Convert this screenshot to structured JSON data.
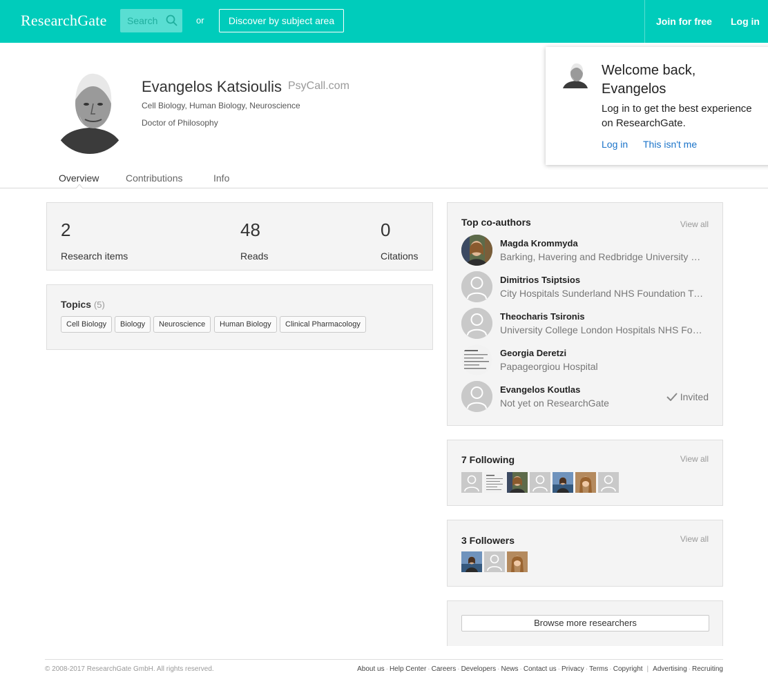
{
  "header": {
    "logo": "ResearchGate",
    "search_placeholder": "Search",
    "or_label": "or",
    "discover_label": "Discover by subject area",
    "join_label": "Join for free",
    "login_label": "Log in",
    "brand_color": "#00ccbb"
  },
  "profile": {
    "name": "Evangelos Katsioulis",
    "website": "PsyCall.com",
    "fields": "Cell Biology, Human Biology, Neuroscience",
    "degree": "Doctor of Philosophy",
    "tabs": [
      "Overview",
      "Contributions",
      "Info"
    ],
    "active_tab": "Overview"
  },
  "popup": {
    "title": "Welcome back, Evangelos",
    "text": "Log in to get the best experience on ResearchGate.",
    "login_link": "Log in",
    "not_me_link": "This isn't me"
  },
  "stats": [
    {
      "value": "2",
      "label": "Research items"
    },
    {
      "value": "48",
      "label": "Reads"
    },
    {
      "value": "0",
      "label": "Citations"
    }
  ],
  "topics": {
    "title": "Topics",
    "count": "(5)",
    "tags": [
      "Cell Biology",
      "Biology",
      "Neuroscience",
      "Human Biology",
      "Clinical Pharmacology"
    ]
  },
  "coauthors": {
    "title": "Top co-authors",
    "view_all": "View all",
    "items": [
      {
        "name": "Magda Krommyda",
        "institution": "Barking, Havering and Redbridge University Hospitals NHS Trust",
        "avatar": "photo-woman-icon"
      },
      {
        "name": "Dimitrios Tsiptsios",
        "institution": "City Hospitals Sunderland NHS Foundation Trust",
        "avatar": "default-user-icon"
      },
      {
        "name": "Theocharis Tsironis",
        "institution": "University College London Hospitals NHS Foundation Trust",
        "avatar": "default-user-icon"
      },
      {
        "name": "Georgia Deretzi",
        "institution": "Papageorgiou Hospital",
        "avatar": "document-photo-icon"
      },
      {
        "name": "Evangelos Koutlas",
        "institution": "Not yet on ResearchGate",
        "avatar": "default-user-icon",
        "status": "Invited"
      }
    ]
  },
  "following": {
    "title": "7 Following",
    "view_all": "View all"
  },
  "followers": {
    "title": "3 Followers",
    "view_all": "View all"
  },
  "browse_label": "Browse more researchers",
  "footer": {
    "copyright": "© 2008-2017 ResearchGate GmbH. All rights reserved.",
    "links": [
      "About us",
      "Help Center",
      "Careers",
      "Developers",
      "News",
      "Contact us",
      "Privacy",
      "Terms",
      "Copyright"
    ],
    "links_extra": [
      "Advertising",
      "Recruiting"
    ]
  }
}
